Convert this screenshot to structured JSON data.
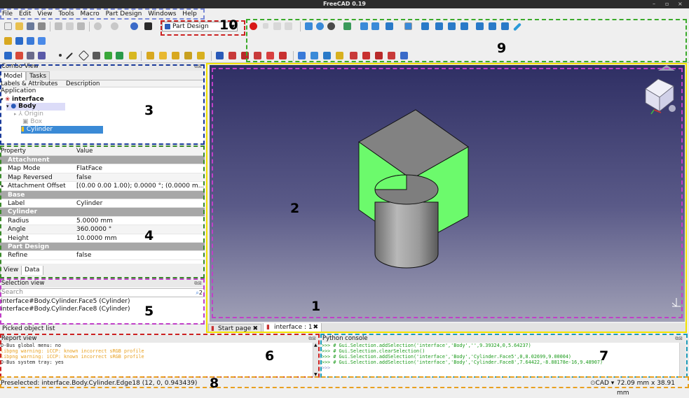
{
  "window": {
    "title": "FreeCAD 0.19",
    "controls": [
      "–",
      "▫",
      "×"
    ]
  },
  "menu": [
    "File",
    "Edit",
    "View",
    "Tools",
    "Macro",
    "Part Design",
    "Windows",
    "Help"
  ],
  "toolbar": {
    "workbench": "Part Design"
  },
  "combo_view": {
    "title": "Combo View",
    "tabs": [
      "Model",
      "Tasks"
    ],
    "columns": [
      "Labels & Attributes",
      "Description"
    ],
    "tree": [
      {
        "label": "Application",
        "indent": 0,
        "icon": "none"
      },
      {
        "label": "interface",
        "indent": 1,
        "icon": "document-icon",
        "bold": true
      },
      {
        "label": "Body",
        "indent": 2,
        "icon": "body-icon",
        "bold": true
      },
      {
        "label": "Origin",
        "indent": 3,
        "icon": "origin-icon",
        "dim": true
      },
      {
        "label": "Box",
        "indent": 3,
        "icon": "box-icon",
        "dim": true
      },
      {
        "label": "Cylinder",
        "indent": 3,
        "icon": "cylinder-icon",
        "selected": true
      }
    ]
  },
  "properties": {
    "columns": [
      "Property",
      "Value"
    ],
    "rows": [
      {
        "group": "Attachment"
      },
      {
        "name": "Map Mode",
        "value": "FlatFace"
      },
      {
        "name": "Map Reversed",
        "value": "false"
      },
      {
        "name": "Attachment Offset",
        "value": "[(0.00 0.00 1.00); 0.0000 °; (0.0000 m...",
        "expand": true
      },
      {
        "group": "Base"
      },
      {
        "name": "Label",
        "value": "Cylinder"
      },
      {
        "group": "Cylinder"
      },
      {
        "name": "Radius",
        "value": "5.0000 mm"
      },
      {
        "name": "Angle",
        "value": "360.0000 °"
      },
      {
        "name": "Height",
        "value": "10.0000 mm"
      },
      {
        "group": "Part Design"
      },
      {
        "name": "Refine",
        "value": "false"
      }
    ],
    "tabs": [
      "View",
      "Data"
    ]
  },
  "selection_view": {
    "title": "Selection view",
    "search_placeholder": "Search",
    "count": "2",
    "items": [
      "interface#Body.Cylinder.Face5 (Cylinder)",
      "interface#Body.Cylinder.Face8 (Cylinder)"
    ],
    "footer": "Picked object list"
  },
  "doc_tabs": [
    "Start page",
    "interface : 1"
  ],
  "report_view": {
    "title": "Report view",
    "lines": [
      {
        "text": "D-Bus global menu: no",
        "color": "#222222"
      },
      {
        "text": "libpng warning: iCCP: known incorrect sRGB profile",
        "color": "#e8a020"
      },
      {
        "text": "libpng warning: iCCP: known incorrect sRGB profile",
        "color": "#e8a020"
      },
      {
        "text": "D-Bus system tray: yes",
        "color": "#222222"
      }
    ]
  },
  "python_console": {
    "title": "Python console",
    "lines": [
      ">>> # Gui.Selection.addSelection('interface','Body','',9.39324,0,5.64237)",
      ">>> # Gui.Selection.clearSelection()",
      ">>> # Gui.Selection.addSelection('interface','Body','Cylinder.Face5',0,8.02699,9.00004)",
      ">>> # Gui.Selection.addSelection('interface','Body','Cylinder.Face8',7.64422,-8.88178e-16,9.48907)",
      ">>>"
    ]
  },
  "status": {
    "left": "Preselected: interface.Body.Cylinder.Edge18 (12, 0, 0.943439)",
    "right_nav": "CAD",
    "right_dims": "72.09 mm x 38.91 mm"
  },
  "callouts": [
    "1",
    "2",
    "3",
    "4",
    "5",
    "6",
    "7",
    "8",
    "9",
    "10"
  ],
  "colors": {
    "callout_1": "#f2e200",
    "callout_2": "#c040c8",
    "callout_3": "#1a3a9a",
    "callout_4": "#3a8a2a",
    "callout_5": "#c040c8",
    "callout_6": "#cc2222",
    "callout_7": "#1a9ab8",
    "callout_8": "#e8a020",
    "callout_9": "#3aaa2a",
    "callout_10": "#cc2222",
    "menu_box": "#7a8ad8",
    "selection_highlight": "#3a8ad6",
    "face_highlight": "#6cfa6c"
  }
}
